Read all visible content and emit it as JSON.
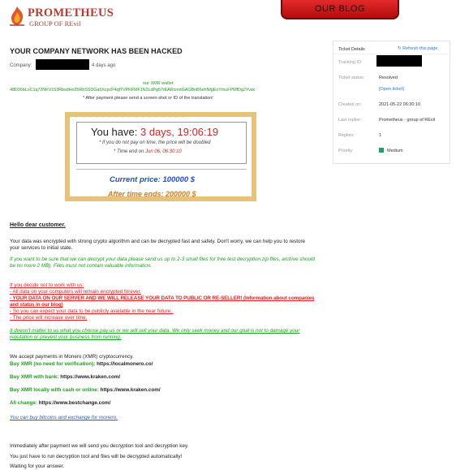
{
  "header": {
    "brand": "PROMETHEUS",
    "brand_sub": "GROUP OF REvil",
    "blog_button": "OUR BLOG"
  },
  "main": {
    "title": "YOUR COMPANY NETWORK HAS BEEN HACKED",
    "company_label": "Company:",
    "company_age": "4 days ago",
    "wallet_label": "our XMR wallet:",
    "wallet_address": "48D26bLoC1q72NKV153RbsdHo25RbSSDGa5XcpcP4qf7VPKFMF1N3LdPg57rEARcnntGAGBnB6ehNfgEoYmuFPMfDg2Yvsk",
    "after_payment_note": "* After payment please send a screen-shot or ID of the translation!",
    "timer": {
      "you_have": "You have:",
      "time_left": "3 days, 19:06:19",
      "if_not_paid": "* If you do not pay on time, the price will be doubled",
      "time_end_label": "* Time end on",
      "time_end_value": "Jun 06, 06:30:10",
      "current_price": "Current price: 100000 $",
      "after_price": "After time ends: 200000 $"
    },
    "hello": "Hello dear customer.",
    "p1": "Your data was encrypted with strong crypto algorithm and can be decrypted fast and safely. Don't worry, we can help you to restore your services to initial state.",
    "p2": "If you want to be sure that we can decrypt your data please send us up to 2-3 small files for free test decryption.zip files, archive should be no more 2 MB). Files must not contain valuable information.",
    "p3_title": "If you decide not to work with us:",
    "p3_l1": "- All data on your computers will remain encrypted forever.",
    "p3_l2": "- YOUR DATA ON OUR SERVER AND WE WILL RELEASE YOUR DATA TO PUBLIC OR RE-SELLER! (Information about companies and status in our blog)",
    "p3_l3": "- So you can expect your data to be publicly available in the near future..",
    "p3_l4": "- The price will increase over time.",
    "p4": "It doesn't matter to us what you choose pay us or we will sell your data. We only seek money and our goal is not to damage your reputation or prevent your business from running.",
    "payments_intro": "We accept payments in Monero (XMR) cryptocurrency.",
    "pay1_label": "Buy XMR (no need for verification):",
    "pay1_url": "https://localmonero.co/",
    "pay2_label": "Buy XMR with bank:",
    "pay2_url": "https://www.kraken.com/",
    "pay3_label": "Buy XMR locally with cash or online:",
    "pay3_url": "https://www.kraken.com/",
    "pay4_label": "All change:",
    "pay4_url": "https://www.bestchange.com/",
    "buy_link": "You can buy bitcoins and exchange for monero.",
    "after1": "Immediately after payment we will send you decryption tool and decryption key.",
    "after2": "You just have to run decryption tool and files will be decrypted automatically!",
    "after3": "Waiting for your answer."
  },
  "ticket": {
    "title": "Ticket Details",
    "refresh": "Refresh this page",
    "tracking_label": "Tracking ID:",
    "status_label": "Ticket status:",
    "status_value": "Resolved",
    "open_ticket": "[Open ticket]",
    "created_label": "Created on:",
    "created_value": "2021-05-22 06:30:10",
    "replier_label": "Last replier:",
    "replier_value": "Prometheus - group of REvil",
    "replies_label": "Replies:",
    "replies_value": "1",
    "priority_label": "Priority:",
    "priority_value": "Medium",
    "priority_color": "#1aa36a"
  }
}
